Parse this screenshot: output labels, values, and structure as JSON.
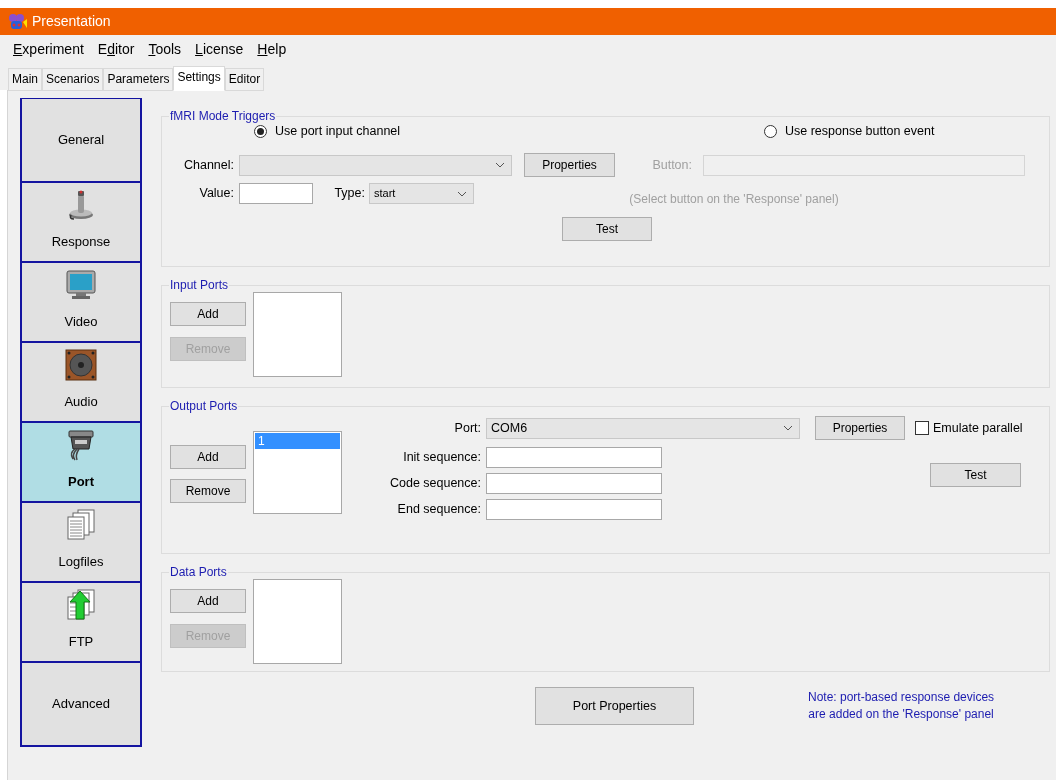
{
  "window": {
    "title": "Presentation"
  },
  "menu": [
    {
      "access_key": "E",
      "after": "xperiment"
    },
    {
      "before": "E",
      "access_key": "d",
      "after": "itor"
    },
    {
      "access_key": "T",
      "after": "ools"
    },
    {
      "access_key": "L",
      "after": "icense"
    },
    {
      "access_key": "H",
      "after": "elp"
    }
  ],
  "tabs": [
    {
      "label": "Main",
      "selected": false
    },
    {
      "label": "Scenarios",
      "selected": false
    },
    {
      "label": "Parameters",
      "selected": false
    },
    {
      "label": "Settings",
      "selected": true
    },
    {
      "label": "Editor",
      "selected": false
    }
  ],
  "sidebar": {
    "items": [
      {
        "label": "General",
        "kind": "none",
        "selected": false
      },
      {
        "label": "Response",
        "kind": "joystick",
        "selected": false
      },
      {
        "label": "Video",
        "kind": "monitor",
        "selected": false
      },
      {
        "label": "Audio",
        "kind": "speaker",
        "selected": false
      },
      {
        "label": "Port",
        "kind": "port",
        "selected": true
      },
      {
        "label": "Logfiles",
        "kind": "documents",
        "selected": false
      },
      {
        "label": "FTP",
        "kind": "upload",
        "selected": false
      },
      {
        "label": "Advanced",
        "kind": "none",
        "selected": false
      }
    ]
  },
  "fmri_triggers": {
    "title": "fMRI Mode Triggers",
    "radios": [
      {
        "label": "Use port input channel",
        "selected": true
      },
      {
        "label": "Use response button event",
        "selected": false
      }
    ],
    "channel": {
      "label": "Channel:"
    },
    "properties_button": "Properties",
    "button_field": {
      "label": "Button:",
      "disabled": true
    },
    "value": {
      "label": "Value:"
    },
    "type": {
      "label": "Type:",
      "value": "start"
    },
    "hint": "(Select button on the 'Response' panel)",
    "test_button": "Test"
  },
  "input_ports": {
    "title": "Input Ports",
    "buttons": [
      {
        "label": "Add",
        "disabled": false
      },
      {
        "label": "Remove",
        "disabled": true
      }
    ]
  },
  "output_ports": {
    "title": "Output Ports",
    "buttons": [
      {
        "label": "Add",
        "disabled": false
      },
      {
        "label": "Remove",
        "disabled": false
      }
    ],
    "items": [
      {
        "label": "1",
        "selected": true
      }
    ],
    "port": {
      "label": "Port:",
      "value": "COM6"
    },
    "properties_button": "Properties",
    "emulate_parallel": {
      "label": "Emulate parallel",
      "checked": false
    },
    "fields": [
      {
        "label": "Init sequence:"
      },
      {
        "label": "Code sequence:"
      },
      {
        "label": "End sequence:"
      }
    ],
    "test_button": "Test"
  },
  "data_ports": {
    "title": "Data Ports",
    "buttons": [
      {
        "label": "Add",
        "disabled": false
      },
      {
        "label": "Remove",
        "disabled": true
      }
    ]
  },
  "footer": {
    "button": "Port Properties",
    "note_lines": [
      "Note: port-based response devices",
      "are added on the 'Response' panel"
    ]
  }
}
